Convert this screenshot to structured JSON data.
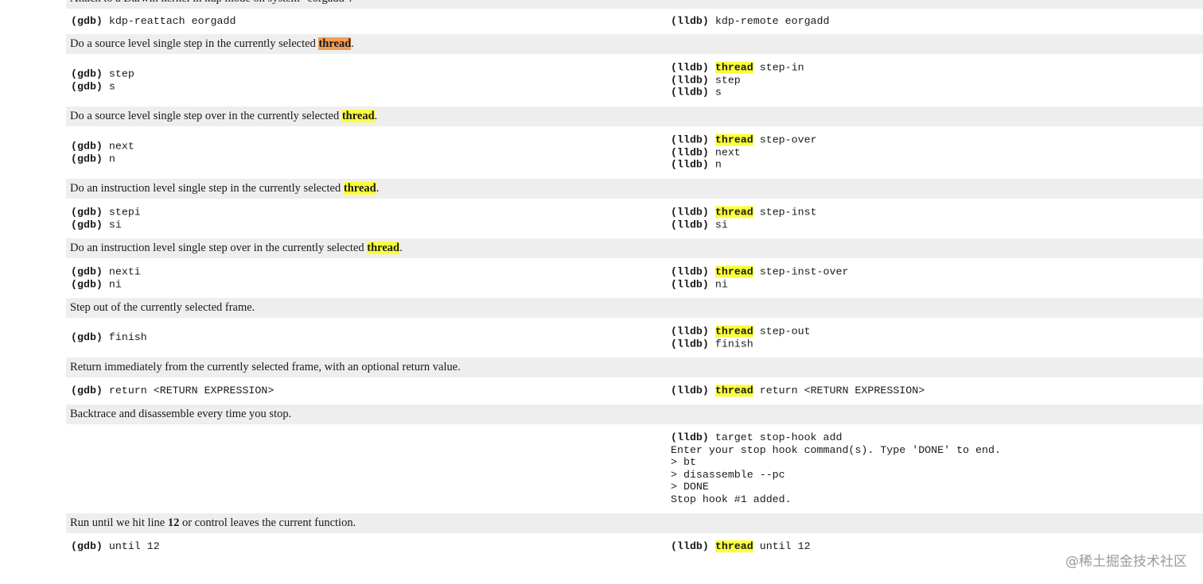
{
  "rows": [
    {
      "desc": [
        {
          "t": "Attach to a Darwin kernel in kdp mode on system \"eorgadd\"."
        }
      ],
      "height": 32,
      "gdb": [
        [
          {
            "t": "(gdb)",
            "k": "p"
          },
          {
            "t": " kdp-reattach eorgadd"
          }
        ]
      ],
      "lldb": [
        [
          {
            "t": "(lldb)",
            "k": "p"
          },
          {
            "t": " kdp-remote eorgadd"
          }
        ]
      ]
    },
    {
      "desc": [
        {
          "t": "Do a source level single step in the currently selected "
        },
        {
          "t": "thread",
          "k": "hl-active"
        },
        {
          "t": "."
        }
      ],
      "height": 66,
      "gdb": [
        [
          {
            "t": "(gdb)",
            "k": "p"
          },
          {
            "t": " step"
          }
        ],
        [
          {
            "t": "(gdb)",
            "k": "p"
          },
          {
            "t": " s"
          }
        ]
      ],
      "lldb": [
        [
          {
            "t": "(lldb)",
            "k": "p"
          },
          {
            "t": " "
          },
          {
            "t": "thread",
            "k": "hl"
          },
          {
            "t": " step-in"
          }
        ],
        [
          {
            "t": "(lldb)",
            "k": "p"
          },
          {
            "t": " step"
          }
        ],
        [
          {
            "t": "(lldb)",
            "k": "p"
          },
          {
            "t": " s"
          }
        ]
      ]
    },
    {
      "desc": [
        {
          "t": "Do a source level single step over in the currently selected "
        },
        {
          "t": "thread",
          "k": "hl"
        },
        {
          "t": "."
        }
      ],
      "height": 66,
      "gdb": [
        [
          {
            "t": "(gdb)",
            "k": "p"
          },
          {
            "t": " next"
          }
        ],
        [
          {
            "t": "(gdb)",
            "k": "p"
          },
          {
            "t": " n"
          }
        ]
      ],
      "lldb": [
        [
          {
            "t": "(lldb)",
            "k": "p"
          },
          {
            "t": " "
          },
          {
            "t": "thread",
            "k": "hl"
          },
          {
            "t": " step-over"
          }
        ],
        [
          {
            "t": "(lldb)",
            "k": "p"
          },
          {
            "t": " next"
          }
        ],
        [
          {
            "t": "(lldb)",
            "k": "p"
          },
          {
            "t": " n"
          }
        ]
      ]
    },
    {
      "desc": [
        {
          "t": "Do an instruction level single step in the currently selected "
        },
        {
          "t": "thread",
          "k": "hl"
        },
        {
          "t": "."
        }
      ],
      "height": 50,
      "gdb": [
        [
          {
            "t": "(gdb)",
            "k": "p"
          },
          {
            "t": " stepi"
          }
        ],
        [
          {
            "t": "(gdb)",
            "k": "p"
          },
          {
            "t": " si"
          }
        ]
      ],
      "lldb": [
        [
          {
            "t": "(lldb)",
            "k": "p"
          },
          {
            "t": " "
          },
          {
            "t": "thread",
            "k": "hl"
          },
          {
            "t": " step-inst"
          }
        ],
        [
          {
            "t": "(lldb)",
            "k": "p"
          },
          {
            "t": " si"
          }
        ]
      ]
    },
    {
      "desc": [
        {
          "t": "Do an instruction level single step over in the currently selected "
        },
        {
          "t": "thread",
          "k": "hl"
        },
        {
          "t": "."
        }
      ],
      "height": 50,
      "gdb": [
        [
          {
            "t": "(gdb)",
            "k": "p"
          },
          {
            "t": " nexti"
          }
        ],
        [
          {
            "t": "(gdb)",
            "k": "p"
          },
          {
            "t": " ni"
          }
        ]
      ],
      "lldb": [
        [
          {
            "t": "(lldb)",
            "k": "p"
          },
          {
            "t": " "
          },
          {
            "t": "thread",
            "k": "hl"
          },
          {
            "t": " step-inst-over"
          }
        ],
        [
          {
            "t": "(lldb)",
            "k": "p"
          },
          {
            "t": " ni"
          }
        ]
      ]
    },
    {
      "desc": [
        {
          "t": "Step out of the currently selected frame."
        }
      ],
      "height": 50,
      "gdb": [
        [
          {
            "t": "(gdb)",
            "k": "p"
          },
          {
            "t": " finish"
          }
        ]
      ],
      "lldb": [
        [
          {
            "t": "(lldb)",
            "k": "p"
          },
          {
            "t": " "
          },
          {
            "t": "thread",
            "k": "hl"
          },
          {
            "t": " step-out"
          }
        ],
        [
          {
            "t": "(lldb)",
            "k": "p"
          },
          {
            "t": " finish"
          }
        ]
      ]
    },
    {
      "desc": [
        {
          "t": "Return immediately from the currently selected frame, with an optional return value."
        }
      ],
      "height": 34,
      "gdb": [
        [
          {
            "t": "(gdb)",
            "k": "p"
          },
          {
            "t": " return <RETURN EXPRESSION>"
          }
        ]
      ],
      "lldb": [
        [
          {
            "t": "(lldb)",
            "k": "p"
          },
          {
            "t": " "
          },
          {
            "t": "thread",
            "k": "hl"
          },
          {
            "t": " return <RETURN EXPRESSION>"
          }
        ]
      ]
    },
    {
      "desc": [
        {
          "t": "Backtrace and disassemble every time you stop."
        }
      ],
      "height": 112,
      "gdb": [],
      "lldb": [
        [
          {
            "t": "(lldb)",
            "k": "p"
          },
          {
            "t": " target stop-hook add"
          }
        ],
        [
          {
            "t": "Enter your stop hook command(s). Type 'DONE' to end."
          }
        ],
        [
          {
            "t": "> bt"
          }
        ],
        [
          {
            "t": "> disassemble --pc"
          }
        ],
        [
          {
            "t": "> DONE"
          }
        ],
        [
          {
            "t": "Stop hook #1 added."
          }
        ]
      ]
    },
    {
      "desc": [
        {
          "t": "Run until we hit line "
        },
        {
          "t": "12",
          "k": "bold"
        },
        {
          "t": " or control leaves the current function."
        }
      ],
      "height": 34,
      "gdb": [
        [
          {
            "t": "(gdb)",
            "k": "p"
          },
          {
            "t": " until 12"
          }
        ]
      ],
      "lldb": [
        [
          {
            "t": "(lldb)",
            "k": "p"
          },
          {
            "t": " "
          },
          {
            "t": "thread",
            "k": "hl"
          },
          {
            "t": " until 12"
          }
        ]
      ]
    }
  ],
  "watermark": "@稀土掘金技术社区"
}
